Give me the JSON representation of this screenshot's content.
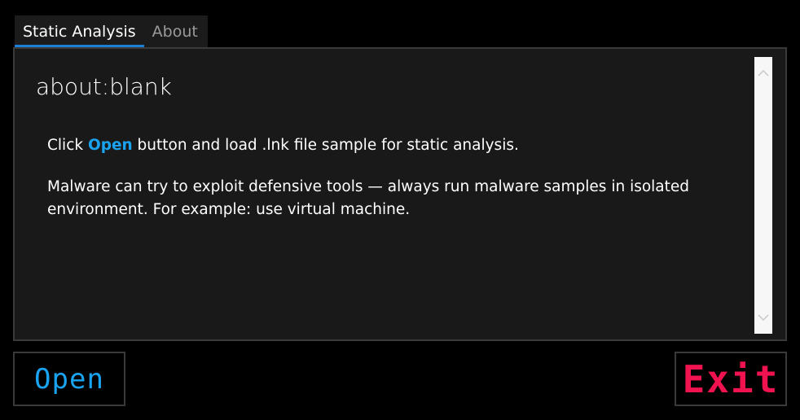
{
  "tabs": [
    {
      "label": "Static Analysis",
      "active": true
    },
    {
      "label": "About",
      "active": false
    }
  ],
  "browser": {
    "title": "about:blank",
    "line1": {
      "before": "Click ",
      "highlight": "Open",
      "after": " button and load .lnk file sample for static analysis."
    },
    "line2": "Malware can try to exploit defensive tools — always run malware samples in isolated environment. For example: use virtual machine."
  },
  "scrollbar": {
    "up_icon": "chevron-up-icon",
    "down_icon": "chevron-down-icon"
  },
  "buttons": {
    "open_label": "Open",
    "exit_label": "Exit"
  },
  "colors": {
    "accent_blue": "#1aa3f0",
    "tab_underline": "#1e7fd8",
    "exit_red": "#f0134f",
    "panel_bg": "#191919"
  }
}
